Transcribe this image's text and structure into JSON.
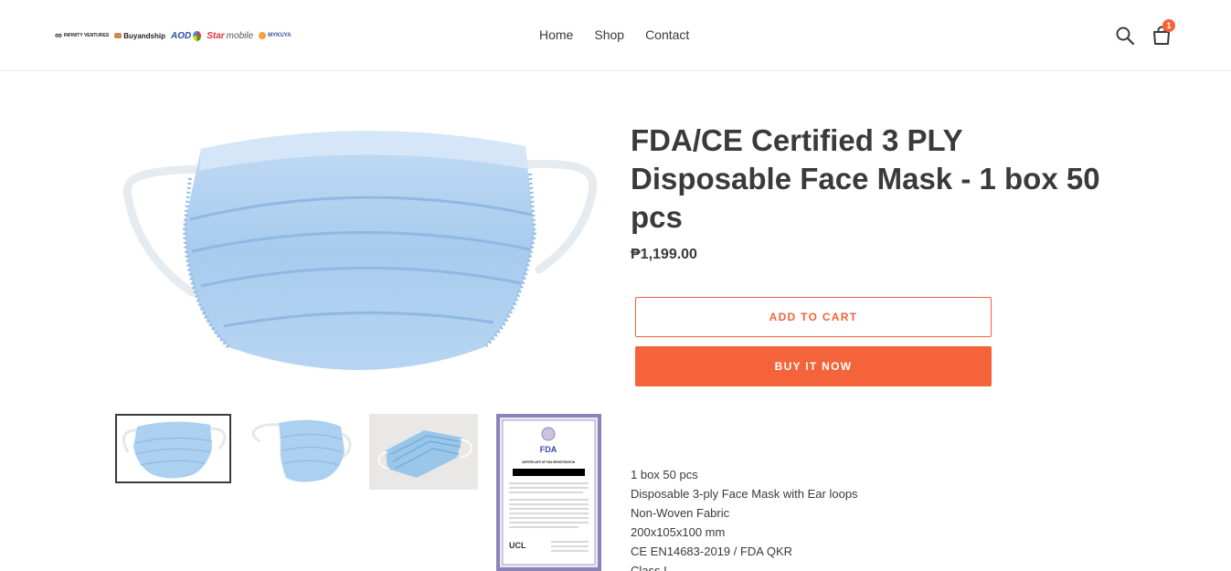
{
  "header": {
    "logos": {
      "infinity": "INFINITY VENTURES",
      "buyandship": "Buyandship",
      "aod": "AOD",
      "starmobile_star": "Star",
      "starmobile_rest": "mobile",
      "mykuya": "MYKUYA"
    },
    "nav": [
      "Home",
      "Shop",
      "Contact"
    ],
    "cart_count": "1",
    "icons": [
      "search-icon",
      "cart-icon"
    ]
  },
  "product": {
    "title": "FDA/CE Certified 3 PLY Disposable Face Mask - 1 box 50 pcs",
    "price": "₱1,199.00",
    "add_to_cart_label": "Add to cart",
    "buy_now_label": "Buy it now",
    "description": [
      "1 box 50 pcs",
      "Disposable 3-ply Face Mask with Ear loops",
      "Non-Woven Fabric",
      "200x105x100 mm",
      "CE EN14683-2019 / FDA QKR",
      "Class I"
    ],
    "certificate": {
      "agency": "FDA",
      "heading": "CERTIFICATE OF FDA REGISTRATION",
      "footer": "UCL"
    }
  },
  "colors": {
    "accent": "#f4633a",
    "text": "#3a3a3a",
    "mask_blue": "#a9cdee"
  }
}
